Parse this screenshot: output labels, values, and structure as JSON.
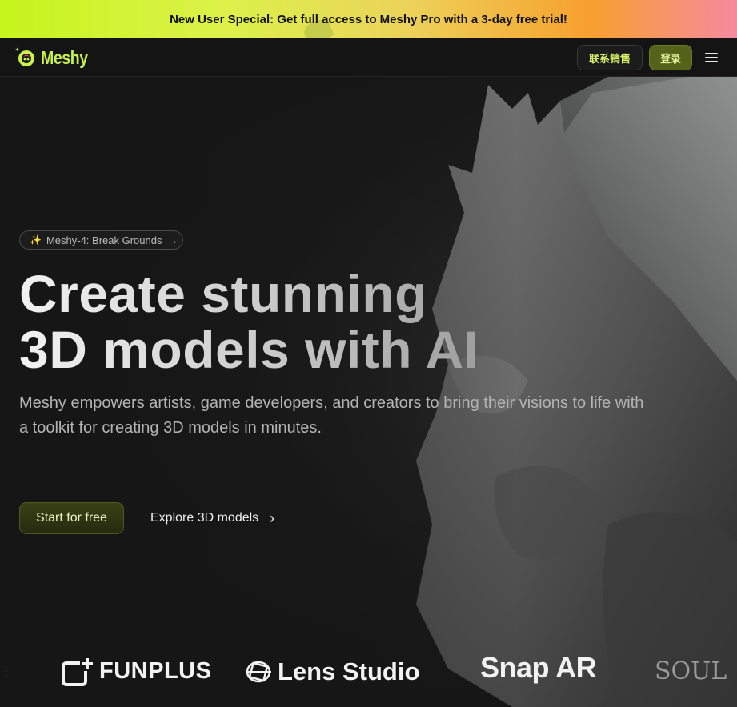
{
  "promo": {
    "text": "New User Special: Get full access to Meshy Pro with a 3-day free trial!"
  },
  "nav": {
    "brand": "Meshy",
    "sales_label": "联系销售",
    "login_label": "登录",
    "menu_icon": "hamburger-icon"
  },
  "hero": {
    "pill_label": "Meshy-4: Break Grounds",
    "pill_icon": "sparkle-icon",
    "headline_line1": "Create stunning",
    "headline_line2": "3D models with AI",
    "subtitle": "Meshy empowers artists, game developers, and creators to bring their visions to life with a toolkit for creating 3D models in minutes.",
    "cta_primary": "Start for free",
    "cta_secondary": "Explore 3D models"
  },
  "partners": {
    "funplus": "FUNPLUS",
    "lens": "Lens Studio",
    "snap": "Snap AR",
    "soul": "SOUL"
  },
  "colors": {
    "accent": "#c9f24d",
    "background": "#161616",
    "login_bg": "#55621a"
  }
}
